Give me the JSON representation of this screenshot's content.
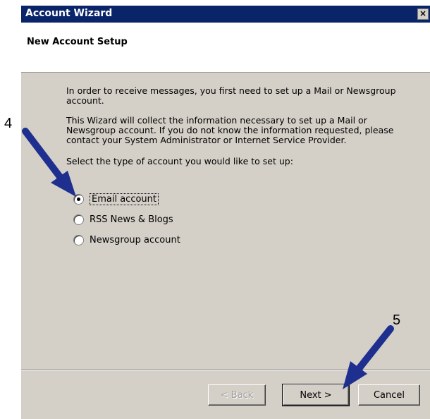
{
  "window": {
    "title": "Account Wizard",
    "close_glyph": "×"
  },
  "header": {
    "title": "New Account Setup"
  },
  "content": {
    "para1": "In order to receive messages, you first need to set up a Mail or Newsgroup account.",
    "para2": "This Wizard will collect the information necessary to set up a Mail or Newsgroup account. If you do not know the information requested, please contact your System Administrator or Internet Service Provider.",
    "para3": "Select the type of account you would like to set up:",
    "options": [
      {
        "label": "Email account",
        "selected": true
      },
      {
        "label": "RSS News & Blogs",
        "selected": false
      },
      {
        "label": "Newsgroup account",
        "selected": false
      }
    ]
  },
  "buttons": {
    "back": "< Back",
    "next": "Next >",
    "cancel": "Cancel"
  },
  "callouts": {
    "step4": "4",
    "step5": "5",
    "arrow_color": "#1f2f8f"
  },
  "colors": {
    "titlebar": "#0a246a",
    "dialog_bg": "#d4d0c8"
  }
}
